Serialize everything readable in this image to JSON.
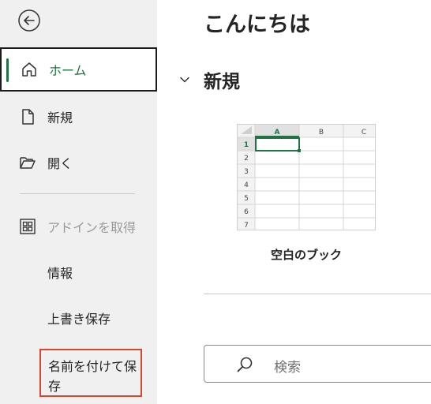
{
  "sidebar": {
    "items": [
      {
        "label": "ホーム",
        "icon": "home-icon"
      },
      {
        "label": "新規",
        "icon": "new-document-icon"
      },
      {
        "label": "開く",
        "icon": "open-folder-icon"
      },
      {
        "label": "アドインを取得",
        "icon": "add-ins-icon"
      },
      {
        "label": "情報"
      },
      {
        "label": "上書き保存"
      },
      {
        "label": "名前を付けて保存"
      }
    ],
    "accent_color": "#217346",
    "highlight_color": "#d9452f"
  },
  "main": {
    "greeting": "こんにちは",
    "new_section": "新規",
    "template": {
      "label": "空白のブック",
      "columns": [
        "A",
        "B",
        "C"
      ],
      "rows": [
        "1",
        "2",
        "3",
        "4",
        "5",
        "6",
        "7"
      ]
    },
    "search": {
      "placeholder": "検索"
    }
  }
}
